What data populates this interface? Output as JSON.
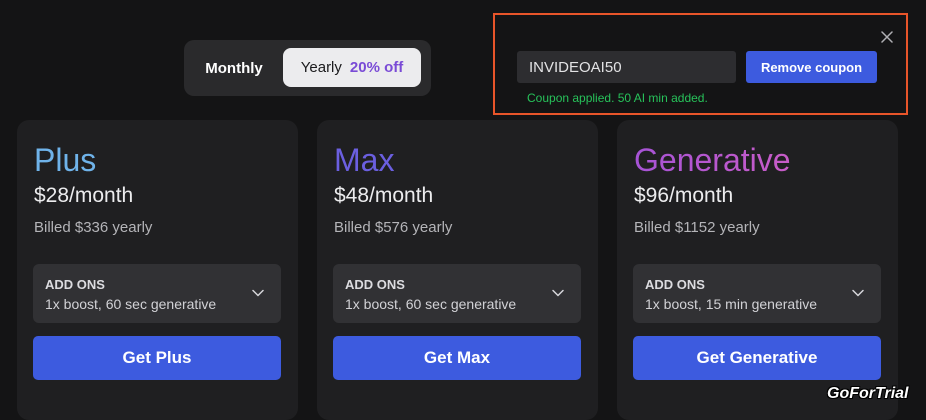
{
  "billing_toggle": {
    "monthly_label": "Monthly",
    "yearly_label": "Yearly",
    "yearly_discount": "20% off",
    "selected": "Yearly"
  },
  "coupon": {
    "code_value": "INVIDEOAI50",
    "remove_label": "Remove coupon",
    "status_text": "Coupon applied. 50 AI min added.",
    "close_icon": "close-icon",
    "status_color": "#27c25a",
    "highlight_border_color": "#e8552a"
  },
  "plans": [
    {
      "name": "Plus",
      "price": "$28/month",
      "billed": "Billed $336 yearly",
      "addons_title": "ADD ONS",
      "addons_desc": "1x boost, 60 sec generative",
      "cta": "Get Plus",
      "name_color": "#6fb3ea"
    },
    {
      "name": "Max",
      "price": "$48/month",
      "billed": "Billed $576 yearly",
      "addons_title": "ADD ONS",
      "addons_desc": "1x boost, 60 sec generative",
      "cta": "Get Max",
      "name_color": "#6b5fe0"
    },
    {
      "name": "Generative",
      "price": "$96/month",
      "billed": "Billed $1152 yearly",
      "addons_title": "ADD ONS",
      "addons_desc": "1x boost, 15 min generative",
      "cta": "Get Generative",
      "name_color": "#a653d6",
      "name_gradient_end": "#c85cc8"
    }
  ],
  "colors": {
    "accent_button": "#3d5bdf",
    "background": "#141415",
    "card_background": "#1f1f21"
  },
  "watermark": "GoForTrial"
}
